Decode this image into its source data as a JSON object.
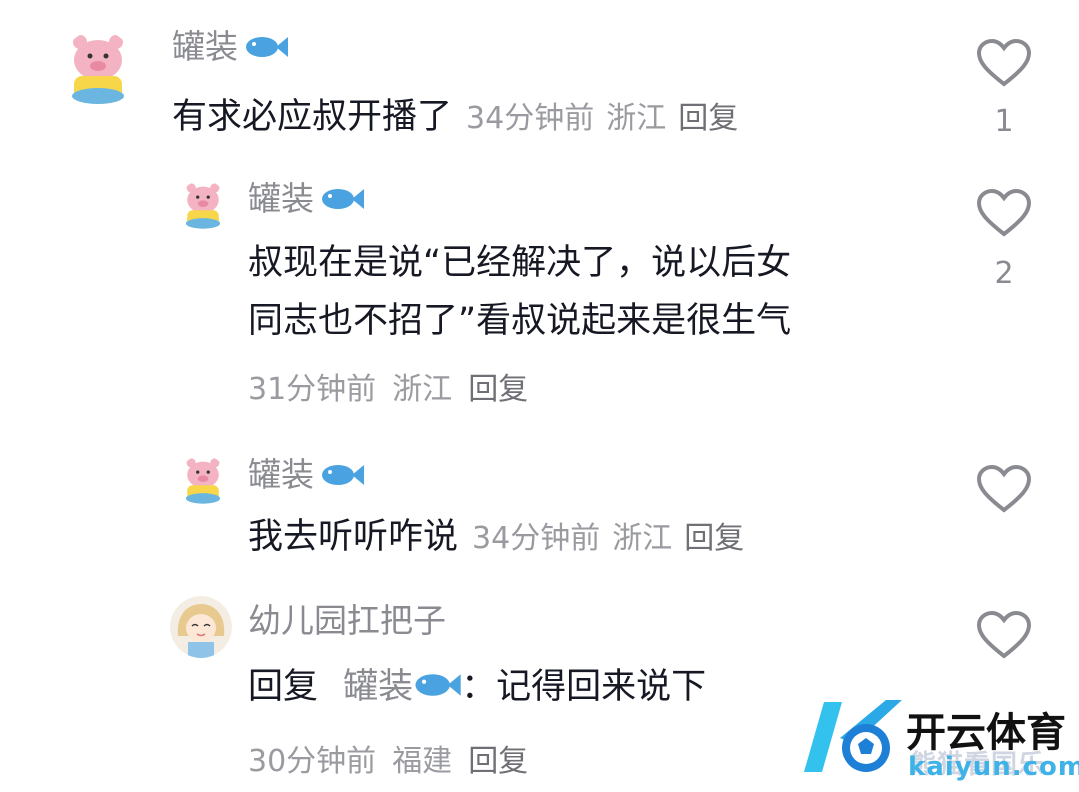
{
  "comments": [
    {
      "username": "罐装",
      "text": "有求必应叔开播了",
      "time": "34分钟前",
      "location": "浙江",
      "reply_label": "回复",
      "likes": "1"
    },
    {
      "username": "罐装",
      "text_line1": "叔现在是说“已经解决了，说以后女",
      "text_line2": "同志也不招了”看叔说起来是很生气",
      "time": "31分钟前",
      "location": "浙江",
      "reply_label": "回复",
      "likes": "2"
    },
    {
      "username": "罐装",
      "text": "我去听听咋说",
      "time": "34分钟前",
      "location": "浙江",
      "reply_label": "回复"
    },
    {
      "username": "幼儿园扛把子",
      "reply_prefix": "回复",
      "reply_to": "罐装",
      "text": "：记得回来说下",
      "time": "30分钟前",
      "location": "福建",
      "reply_label": "回复"
    }
  ],
  "watermark": {
    "brand": "开云体育",
    "domain": "kaiyun.com",
    "overlay": "熊猫看国乐"
  },
  "colors": {
    "accent_fish": "#4aa3e0",
    "text": "#161823",
    "meta": "#9a9ba0"
  },
  "icons": [
    "heart-icon",
    "fish-emoji-icon",
    "pig-avatar",
    "girl-avatar",
    "kaiyun-logo-icon"
  ]
}
